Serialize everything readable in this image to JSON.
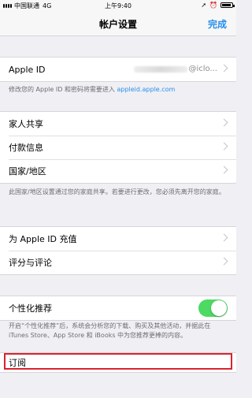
{
  "status": {
    "carrier": "中国联通",
    "network": "4G",
    "time": "上午9:40"
  },
  "nav": {
    "title": "帐户设置",
    "done": "完成"
  },
  "apple_id": {
    "label": "Apple ID",
    "value_suffix": "@iclo..."
  },
  "apple_id_note": {
    "text": "修改您的 Apple ID 和密码将需要进入 ",
    "link": "appleid.apple.com"
  },
  "group2": [
    "家人共享",
    "付款信息",
    "国家/地区"
  ],
  "region_note": "此国家/地区设置通过您的家庭共享。若要进行更改，您必须先离开您的家庭。",
  "group3": [
    "为 Apple ID 充值",
    "评分与评论"
  ],
  "personalization": {
    "label": "个性化推荐",
    "enabled": true
  },
  "personalization_note": "开启“个性化推荐”后，系统会分析您的下载、购买及其他活动，并据此在 iTunes Store、App Store 和 iBooks 中为您推荐更棒的内容。",
  "subscriptions": {
    "label": "订阅"
  },
  "colors": {
    "accent": "#2a8fe8",
    "toggle_on": "#4cd964",
    "highlight": "#d9232d"
  }
}
